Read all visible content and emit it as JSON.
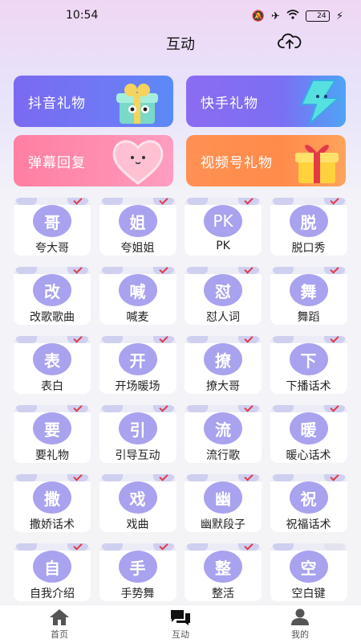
{
  "status_bar": {
    "time": "10:54",
    "battery": "24"
  },
  "header": {
    "title": "互动",
    "upload_icon": "cloud-upload-icon"
  },
  "banners": [
    {
      "label": "抖音礼物"
    },
    {
      "label": "快手礼物"
    },
    {
      "label": "弹幕回复"
    },
    {
      "label": "视频号礼物"
    }
  ],
  "grid": [
    {
      "glyph": "哥",
      "label": "夸大哥"
    },
    {
      "glyph": "姐",
      "label": "夸姐姐"
    },
    {
      "glyph": "PK",
      "label": "PK"
    },
    {
      "glyph": "脱",
      "label": "脱口秀"
    },
    {
      "glyph": "改",
      "label": "改歌歌曲"
    },
    {
      "glyph": "喊",
      "label": "喊麦"
    },
    {
      "glyph": "怼",
      "label": "怼人词"
    },
    {
      "glyph": "舞",
      "label": "舞蹈"
    },
    {
      "glyph": "表",
      "label": "表白"
    },
    {
      "glyph": "开",
      "label": "开场暖场"
    },
    {
      "glyph": "撩",
      "label": "撩大哥"
    },
    {
      "glyph": "下",
      "label": "下播话术"
    },
    {
      "glyph": "要",
      "label": "要礼物"
    },
    {
      "glyph": "引",
      "label": "引导互动"
    },
    {
      "glyph": "流",
      "label": "流行歌"
    },
    {
      "glyph": "暖",
      "label": "暖心话术"
    },
    {
      "glyph": "撒",
      "label": "撒娇话术"
    },
    {
      "glyph": "戏",
      "label": "戏曲"
    },
    {
      "glyph": "幽",
      "label": "幽默段子"
    },
    {
      "glyph": "祝",
      "label": "祝福话术"
    },
    {
      "glyph": "自",
      "label": "自我介绍"
    },
    {
      "glyph": "手",
      "label": "手势舞"
    },
    {
      "glyph": "整",
      "label": "整活"
    },
    {
      "glyph": "空",
      "label": "空白键"
    }
  ],
  "bottom_nav": [
    {
      "label": "首页",
      "icon": "home-icon"
    },
    {
      "label": "互动",
      "icon": "chat-icon"
    },
    {
      "label": "我的",
      "icon": "user-icon"
    }
  ],
  "colors": {
    "accent": "#a9a2ee",
    "check": "#e03a4a"
  }
}
